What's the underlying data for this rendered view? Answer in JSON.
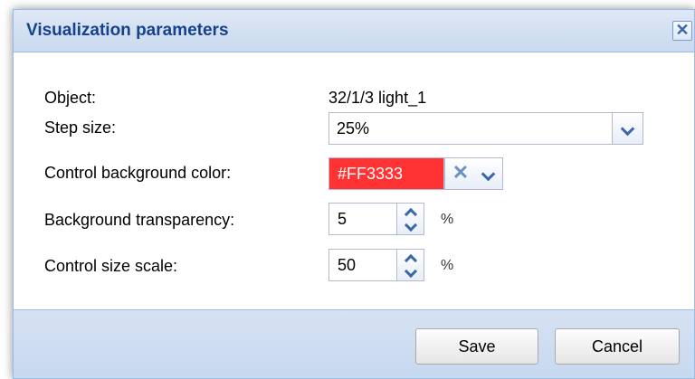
{
  "dialog": {
    "title": "Visualization parameters",
    "close_glyph": "✕"
  },
  "fields": {
    "object": {
      "label": "Object:",
      "value": "32/1/3 light_1"
    },
    "step_size": {
      "label": "Step size:",
      "value": "25%"
    },
    "bg_color": {
      "label": "Control background color:",
      "value": "#FF3333",
      "swatch": "#ff3333",
      "clear_glyph": "✕"
    },
    "bg_transparency": {
      "label": "Background transparency:",
      "value": "5",
      "unit": "%"
    },
    "size_scale": {
      "label": "Control size scale:",
      "value": "50",
      "unit": "%"
    }
  },
  "footer": {
    "save_label": "Save",
    "cancel_label": "Cancel"
  },
  "colors": {
    "title_text": "#15428b",
    "accent": "#3a67a8",
    "footer_bg": "#c7d8ef"
  }
}
